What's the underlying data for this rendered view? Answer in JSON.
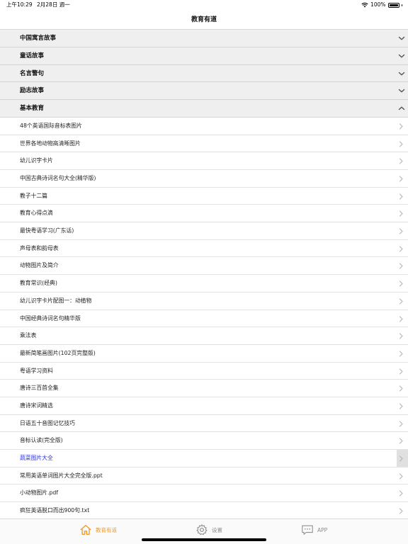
{
  "status": {
    "time": "上午10:29",
    "date": "2月28日 週一",
    "battery": "100%"
  },
  "nav": {
    "title": "教育有道"
  },
  "sections": [
    {
      "label": "中国寓言故事",
      "expanded": false
    },
    {
      "label": "童话故事",
      "expanded": false
    },
    {
      "label": "名言警句",
      "expanded": false
    },
    {
      "label": "励志故事",
      "expanded": false
    },
    {
      "label": "基本教育",
      "expanded": true
    }
  ],
  "items": [
    {
      "label": "48个英语国际音标表图片"
    },
    {
      "label": "世界各地动物高清晰图片"
    },
    {
      "label": "幼儿识字卡片"
    },
    {
      "label": "中国古典诗词名句大全(精华版)"
    },
    {
      "label": "教子十二篇"
    },
    {
      "label": "教育心得点滴"
    },
    {
      "label": "最快粤语学习(广东话)"
    },
    {
      "label": "声母表和韵母表"
    },
    {
      "label": "动物图片及简介"
    },
    {
      "label": "教育常识(经典)"
    },
    {
      "label": "幼儿识字卡片配图一：动植物"
    },
    {
      "label": "中国经典诗词名句精华版"
    },
    {
      "label": "乘法表"
    },
    {
      "label": "最新简笔画图片(102页完整版)"
    },
    {
      "label": "粤语学习资料"
    },
    {
      "label": "唐诗三百首全集"
    },
    {
      "label": "唐诗宋词精选"
    },
    {
      "label": "日语五十音图记忆技巧"
    },
    {
      "label": "音标认读(完全版)"
    },
    {
      "label": "蔬菜图片大全",
      "highlighted": true
    },
    {
      "label": "常用英语单词图片大全完全版.ppt"
    },
    {
      "label": "小动物图片.pdf"
    },
    {
      "label": "疯狂英语脱口而出900句.txt"
    }
  ],
  "tabs": [
    {
      "label": "教育有道",
      "icon": "home-icon",
      "active": true
    },
    {
      "label": "设置",
      "icon": "gear-icon",
      "active": false
    },
    {
      "label": "APP",
      "icon": "chat-bubble-icon",
      "active": false
    }
  ],
  "colors": {
    "accent": "#f09a2b",
    "link": "#2b32d6",
    "header_bg": "#efeff0"
  }
}
